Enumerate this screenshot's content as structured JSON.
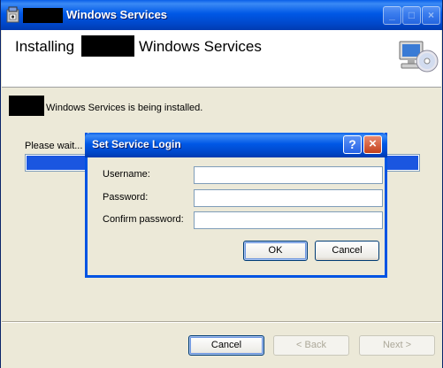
{
  "window": {
    "title": "Windows Services",
    "heading_prefix": "Installing",
    "heading_suffix": "Windows Services",
    "status_text": "Windows Services is being installed.",
    "please_wait": "Please wait...",
    "progress_fraction": 1.0,
    "buttons": {
      "cancel": "Cancel",
      "back": "< Back",
      "next": "Next >"
    },
    "titlebar_buttons": {
      "minimize": "_",
      "maximize": "□",
      "close": "×"
    }
  },
  "dialog": {
    "title": "Set Service Login",
    "help_glyph": "?",
    "close_glyph": "×",
    "fields": [
      {
        "label": "Username:",
        "value": ""
      },
      {
        "label": "Password:",
        "value": ""
      },
      {
        "label": "Confirm password:",
        "value": ""
      }
    ],
    "ok": "OK",
    "cancel": "Cancel"
  },
  "colors": {
    "titlebar": "#0058e6",
    "window_bg": "#ece9d8",
    "progress_fill": "#1a56e0"
  },
  "icons": [
    "installer-app-icon",
    "computer-cd-icon",
    "help-icon",
    "close-icon"
  ]
}
